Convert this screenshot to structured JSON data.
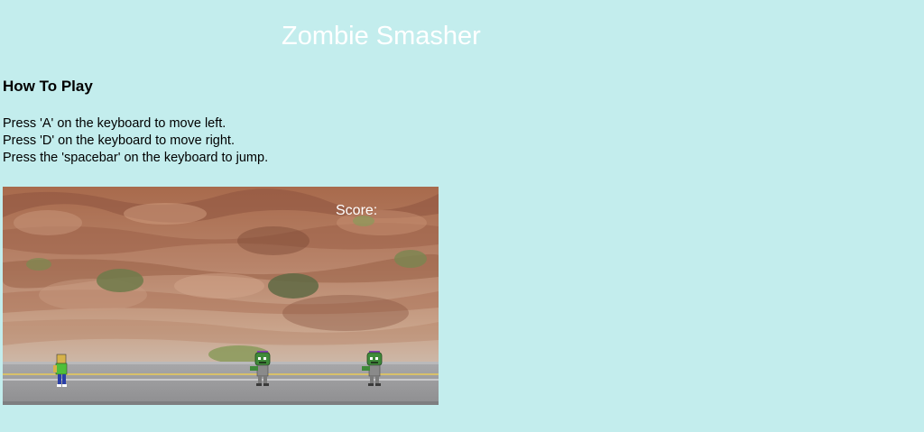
{
  "title": "Zombie Smasher",
  "how_to_play": {
    "heading": "How To Play",
    "instructions": [
      "Press 'A' on the keyboard to move left.",
      "Press 'D' on the keyboard to move right.",
      "Press the 'spacebar' on the keyboard to jump."
    ]
  },
  "game": {
    "score_label": "Score:",
    "colors": {
      "page_background": "#c3eded",
      "rock": "#b07a5c",
      "road": "#9a9a9a",
      "road_line": "#d8c06a",
      "zombie_skin": "#3f8a3a",
      "zombie_shirt": "#8a8a8a",
      "zombie_hair": "#8a3fb5",
      "player_shirt": "#4fbf3a",
      "player_skin": "#d6b24a",
      "player_pants": "#2a3fa8"
    },
    "entities": [
      "player-sprite",
      "zombie-sprite",
      "zombie-sprite"
    ]
  }
}
